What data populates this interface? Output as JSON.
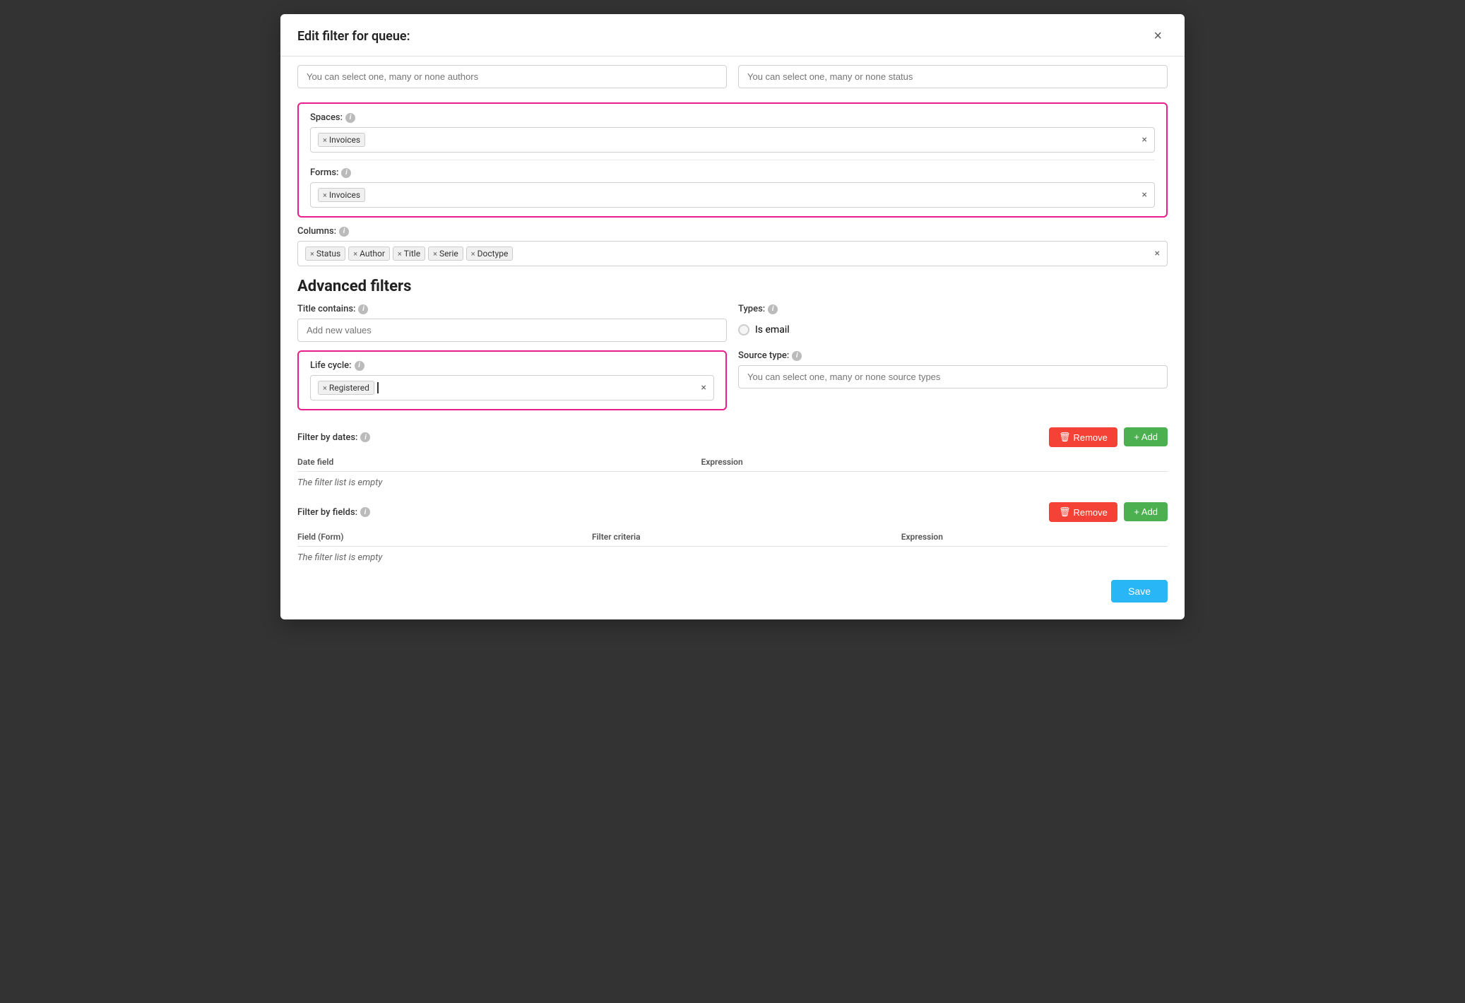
{
  "modal": {
    "title": "Edit filter for queue:",
    "close_label": "×"
  },
  "author_field": {
    "placeholder": "You can select one, many or none authors"
  },
  "status_field": {
    "placeholder": "You can select one, many or none status"
  },
  "spaces": {
    "label": "Spaces:",
    "tags": [
      "Invoices"
    ],
    "clear": "×"
  },
  "forms": {
    "label": "Forms:",
    "tags": [
      "Invoices"
    ],
    "clear": "×"
  },
  "columns": {
    "label": "Columns:",
    "tags": [
      "Status",
      "Author",
      "Title",
      "Serie",
      "Doctype"
    ],
    "clear": "×"
  },
  "advanced_filters": {
    "title": "Advanced filters"
  },
  "title_contains": {
    "label": "Title contains:",
    "placeholder": "Add new values"
  },
  "types": {
    "label": "Types:",
    "is_email_label": "Is email"
  },
  "lifecycle": {
    "label": "Life cycle:",
    "tags": [
      "Registered"
    ],
    "clear": "×"
  },
  "source_type": {
    "label": "Source type:",
    "placeholder": "You can select one, many or none source types"
  },
  "filter_by_dates": {
    "label": "Filter by dates:",
    "remove_label": "Remove",
    "add_label": "+ Add",
    "columns": [
      "Date field",
      "Expression"
    ],
    "empty_message": "The filter list is empty"
  },
  "filter_by_fields": {
    "label": "Filter by fields:",
    "remove_label": "Remove",
    "add_label": "+ Add",
    "columns": [
      "Field (Form)",
      "Filter criteria",
      "Expression"
    ],
    "empty_message": "The filter list is empty"
  },
  "save_button": "Save",
  "info_icon": "i",
  "trash_icon": "🗑",
  "plus_icon": "+"
}
